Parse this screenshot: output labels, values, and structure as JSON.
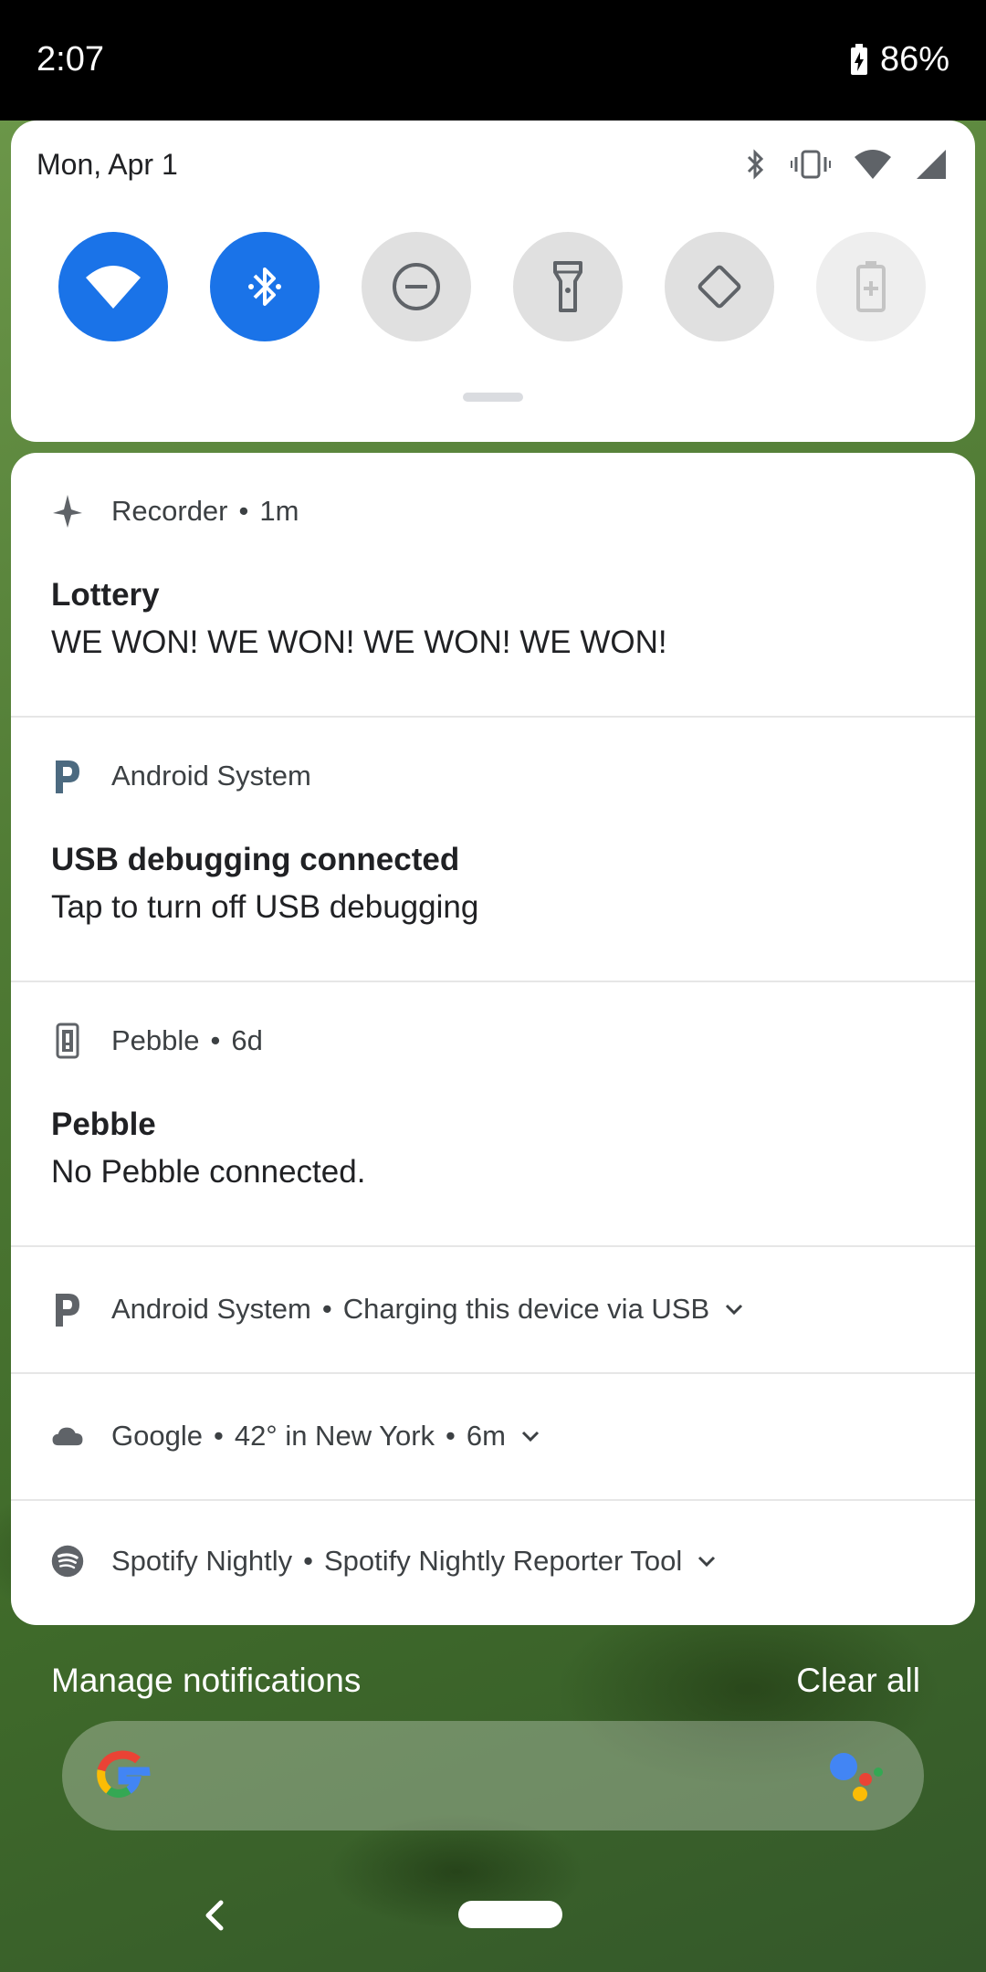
{
  "status_bar": {
    "time": "2:07",
    "battery": "86%"
  },
  "quick_settings": {
    "date": "Mon, Apr 1",
    "tiles": [
      "wifi-tile",
      "bluetooth-tile",
      "do-not-disturb-tile",
      "flashlight-tile",
      "auto-rotate-tile",
      "battery-saver-tile"
    ],
    "active_color": "#1a73e8"
  },
  "notifications": [
    {
      "app": "Recorder",
      "time": "1m",
      "title": "Lottery",
      "body": "WE WON! WE WON! WE WON! WE WON!"
    },
    {
      "app": "Android System",
      "title": "USB debugging connected",
      "body": "Tap to turn off USB debugging"
    },
    {
      "app": "Pebble",
      "time": "6d",
      "title": "Pebble",
      "body": "No Pebble connected."
    },
    {
      "app": "Android System",
      "summary": "Charging this device via USB"
    },
    {
      "app": "Google",
      "summary": "42° in New York",
      "time": "6m"
    },
    {
      "app": "Spotify Nightly",
      "summary": "Spotify Nightly Reporter Tool"
    }
  ],
  "footer": {
    "manage": "Manage notifications",
    "clear": "Clear all"
  }
}
